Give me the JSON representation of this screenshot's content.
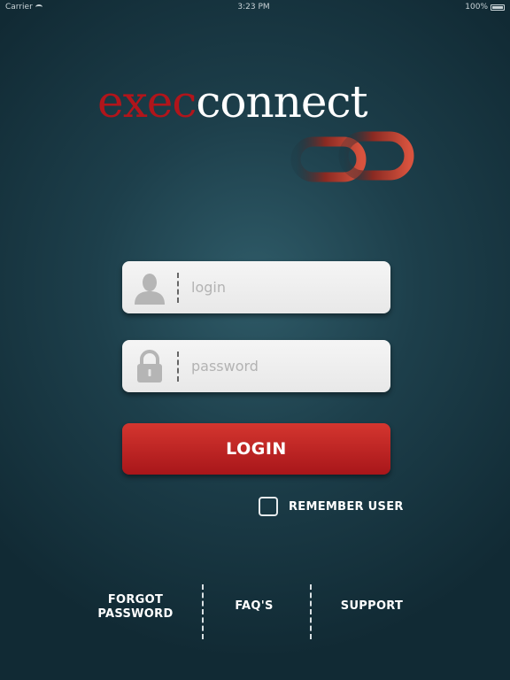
{
  "status_bar": {
    "carrier": "Carrier",
    "time": "3:23 PM",
    "battery": "100%"
  },
  "logo": {
    "part1": "exec",
    "part2": "connect",
    "icon": "chain-link-icon"
  },
  "login_form": {
    "username_placeholder": "login",
    "username_value": "",
    "username_icon": "user-icon",
    "password_placeholder": "password",
    "password_value": "",
    "password_icon": "lock-icon",
    "submit_label": "LOGIN",
    "remember_label": "REMEMBER USER",
    "remember_checked": false
  },
  "footer": {
    "forgot_line1": "FORGOT",
    "forgot_line2": "PASSWORD",
    "faq": "FAQ'S",
    "support": "SUPPORT"
  },
  "colors": {
    "brand_red": "#b1151b",
    "background": "#1d3f4b",
    "button_red": "#c02a26"
  }
}
